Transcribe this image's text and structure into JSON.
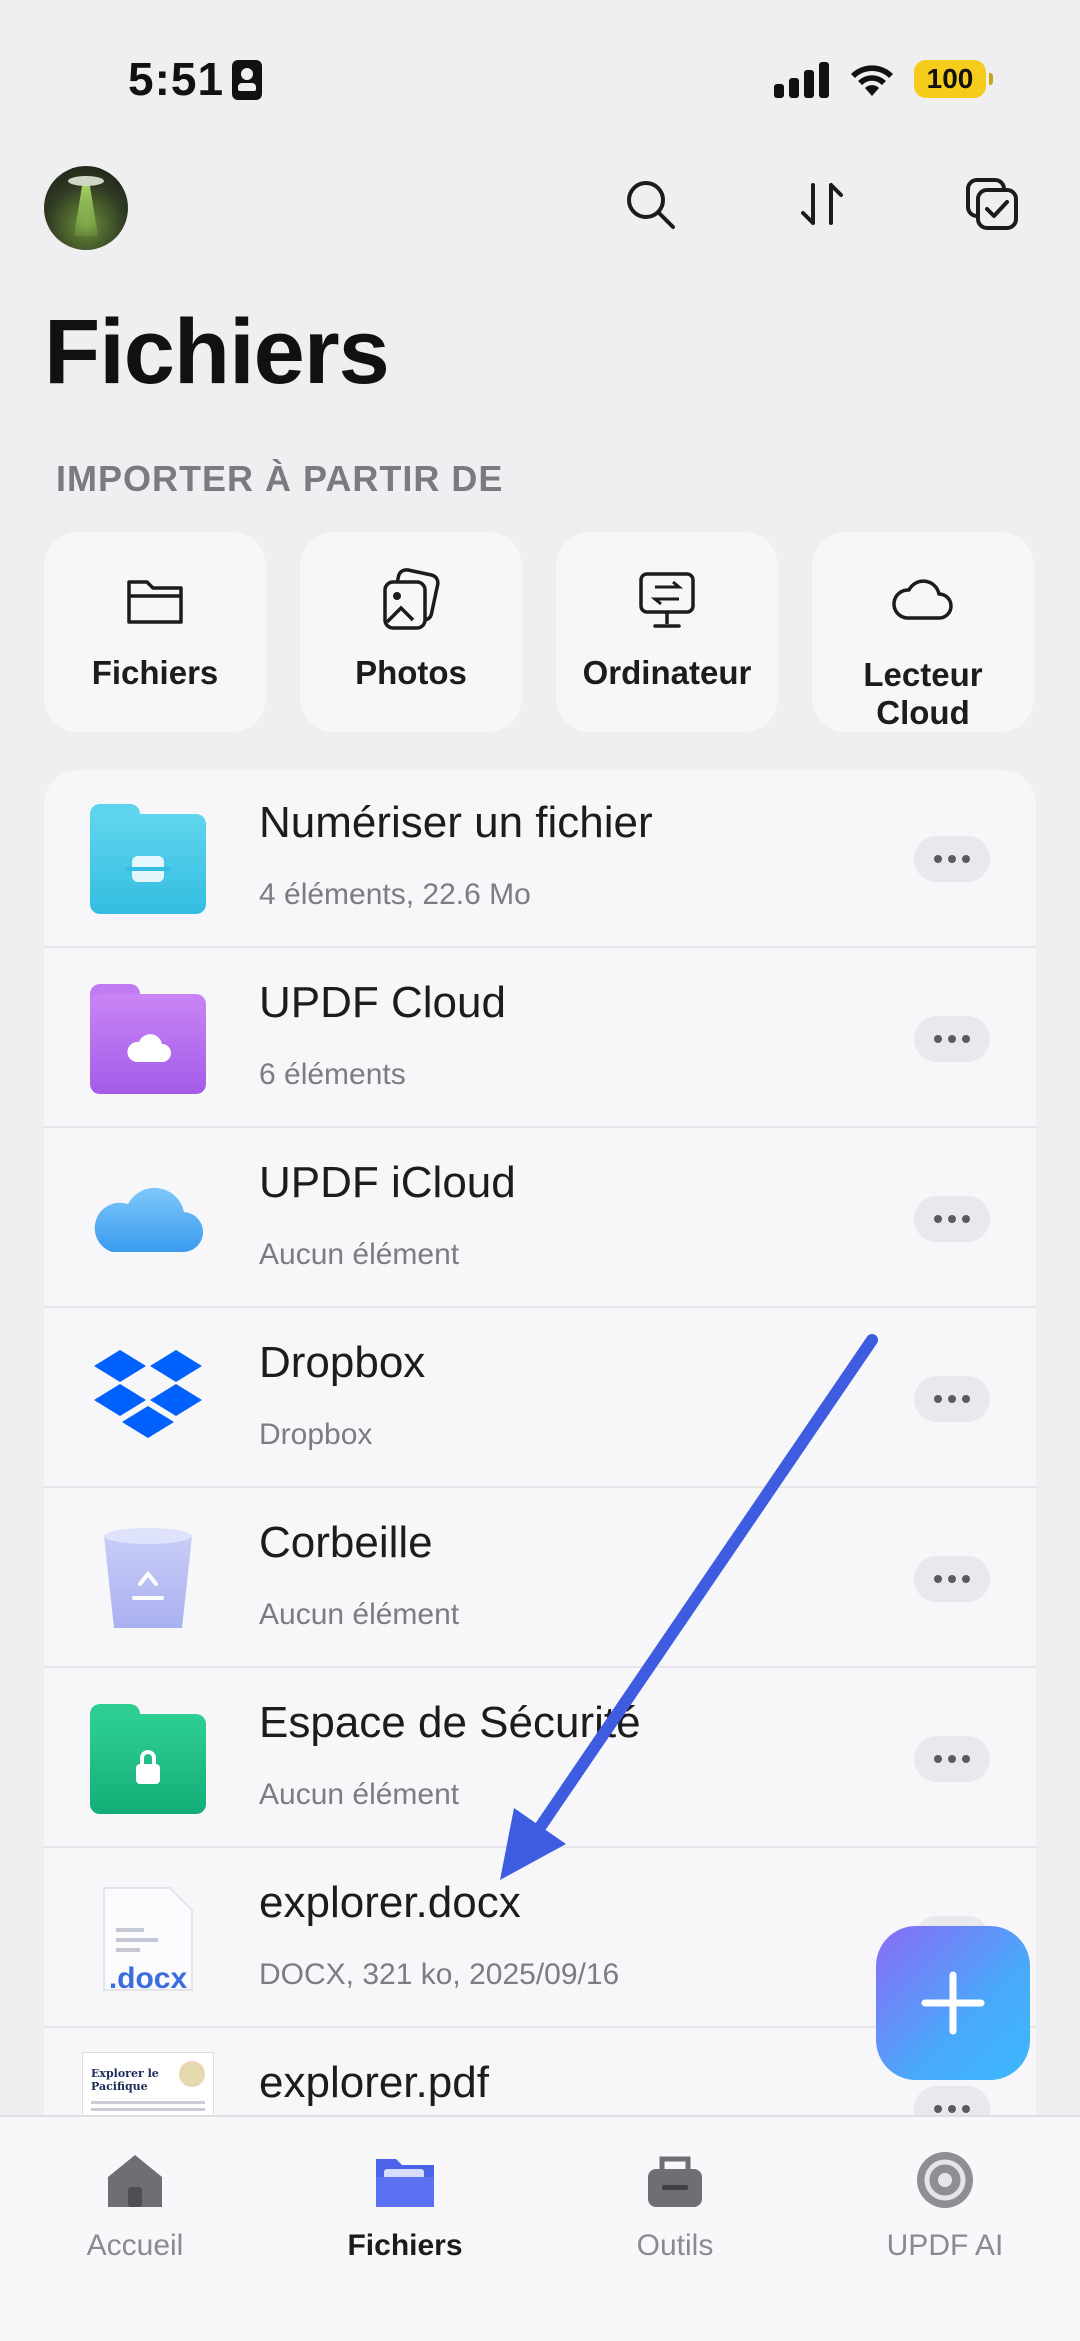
{
  "status_bar": {
    "time": "5:51",
    "battery": "100"
  },
  "header": {
    "title": "Fichiers",
    "section_label": "IMPORTER À PARTIR DE"
  },
  "import_sources": [
    {
      "label": "Fichiers",
      "icon": "folder-icon"
    },
    {
      "label": "Photos",
      "icon": "photos-icon"
    },
    {
      "label": "Ordinateur",
      "icon": "computer-transfer-icon"
    },
    {
      "label": "Lecteur Cloud",
      "icon": "cloud-icon"
    }
  ],
  "files": [
    {
      "name": "Numériser un fichier",
      "meta": "4 éléments, 22.6 Mo",
      "icon": "scan-folder-icon",
      "color": "#3cc6e4"
    },
    {
      "name": "UPDF Cloud",
      "meta": "6 éléments",
      "icon": "updf-cloud-folder-icon",
      "color": "#b46cf0"
    },
    {
      "name": "UPDF iCloud",
      "meta": "Aucun élément",
      "icon": "icloud-icon",
      "color": "#5fb3f6"
    },
    {
      "name": "Dropbox",
      "meta": "Dropbox",
      "icon": "dropbox-icon",
      "color": "#0061fe"
    },
    {
      "name": "Corbeille",
      "meta": "Aucun élément",
      "icon": "trash-icon",
      "color": "#b9bff3"
    },
    {
      "name": "Espace de Sécurité",
      "meta": "Aucun élément",
      "icon": "security-folder-icon",
      "color": "#1fbf85"
    },
    {
      "name": "explorer.docx",
      "meta": "DOCX, 321 ko, 2025/09/16",
      "icon": "docx-file-icon",
      "badge": ".docx"
    },
    {
      "name": "explorer.pdf",
      "meta": "",
      "icon": "pdf-thumbnail-icon",
      "thumb_title": "Explorer le Pacifique"
    }
  ],
  "tabs": [
    {
      "label": "Accueil",
      "icon": "home-icon",
      "active": false
    },
    {
      "label": "Fichiers",
      "icon": "files-tab-icon",
      "active": true
    },
    {
      "label": "Outils",
      "icon": "tools-icon",
      "active": false
    },
    {
      "label": "UPDF AI",
      "icon": "ai-icon",
      "active": false
    }
  ],
  "colors": {
    "accent": "#4a63e8",
    "fab_start": "#8a6bf5",
    "fab_end": "#3bb8fc",
    "annotation_arrow": "#3d5ce0"
  }
}
